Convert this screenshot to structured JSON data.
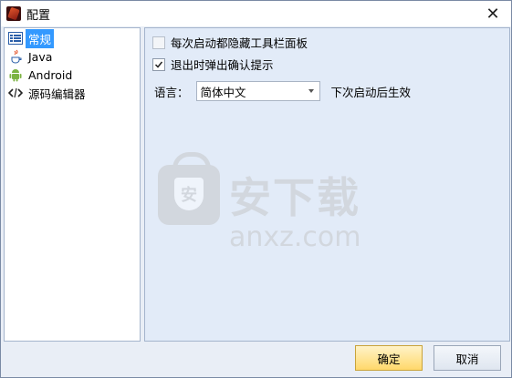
{
  "window": {
    "title": "配置",
    "close_glyph": "✕"
  },
  "sidebar": {
    "items": [
      {
        "label": "常规",
        "icon": "list-icon",
        "selected": true
      },
      {
        "label": "Java",
        "icon": "java-icon",
        "selected": false
      },
      {
        "label": "Android",
        "icon": "android-icon",
        "selected": false
      },
      {
        "label": "源码编辑器",
        "icon": "code-icon",
        "selected": false
      }
    ]
  },
  "settings": {
    "hide_toolbar": {
      "label": "每次启动都隐藏工具栏面板",
      "checked": false
    },
    "confirm_exit": {
      "label": "退出时弹出确认提示",
      "checked": true
    },
    "language": {
      "label": "语言：",
      "value": "简体中文",
      "hint": "下次启动后生效"
    }
  },
  "watermark": {
    "cn": "安下载",
    "en": "anxz.com",
    "badge": "安"
  },
  "footer": {
    "ok_label": "确定",
    "cancel_label": "取消"
  },
  "colors": {
    "selection": "#3399ff",
    "ok_button": "#ffd86b",
    "panel": "#e2ebf8"
  }
}
